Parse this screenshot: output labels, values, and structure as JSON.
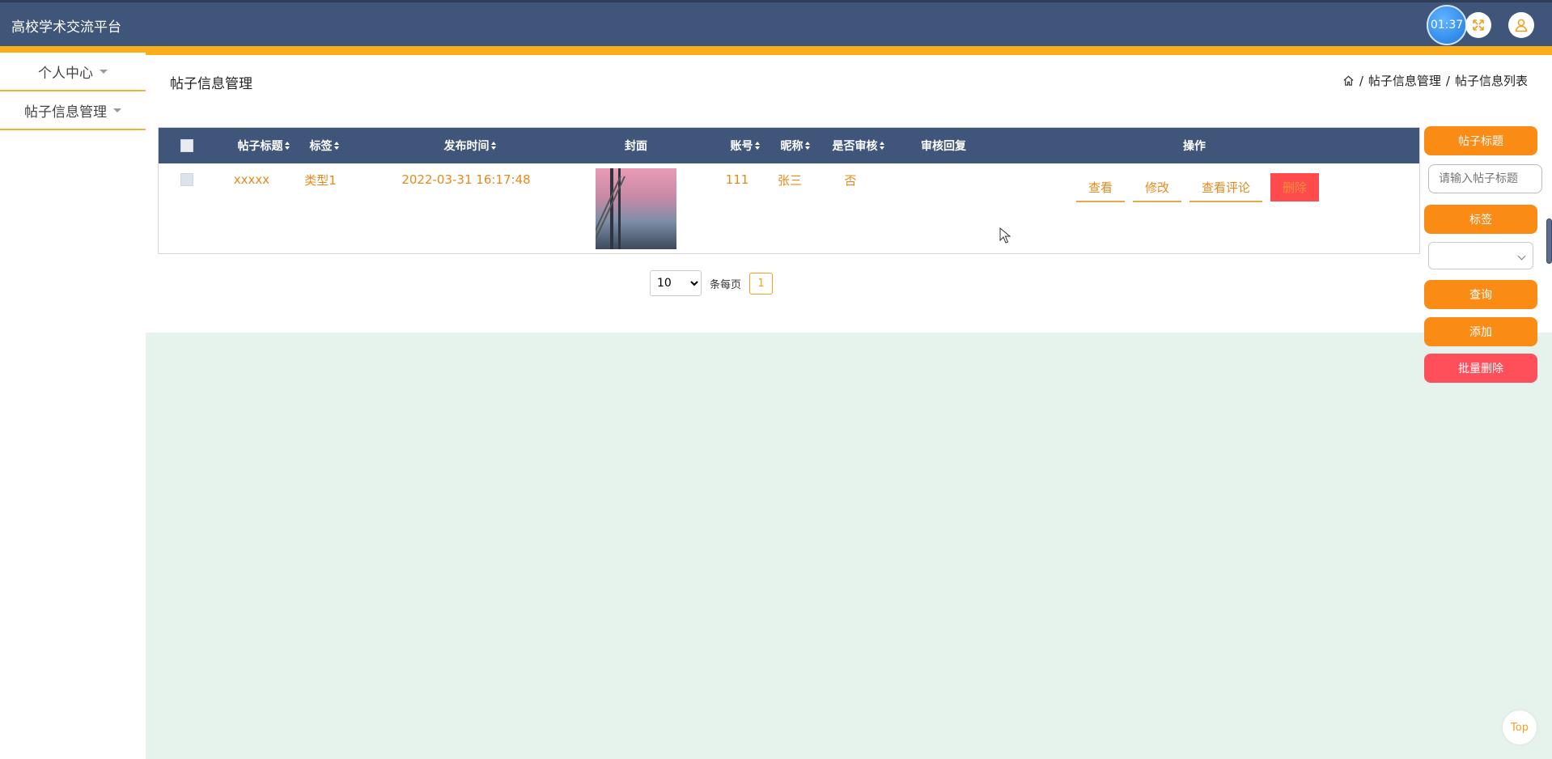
{
  "header": {
    "app_title": "高校学术交流平台",
    "timer": "01:37",
    "colors": {
      "bar": "#40557a",
      "accent": "#fbad1a"
    }
  },
  "sidebar": {
    "items": [
      {
        "label": "个人中心"
      },
      {
        "label": "帖子信息管理"
      }
    ]
  },
  "page": {
    "title": "帖子信息管理",
    "breadcrumb": [
      "帖子信息管理",
      "帖子信息列表"
    ],
    "breadcrumb_sep": "/"
  },
  "table": {
    "columns": [
      "帖子标题",
      "标签",
      "发布时间",
      "封面",
      "账号",
      "昵称",
      "是否审核",
      "审核回复",
      "操作"
    ],
    "rows": [
      {
        "title": "xxxxx",
        "tag": "类型1",
        "time": "2022-03-31 16:17:48",
        "account": "111",
        "nickname": "张三",
        "reviewed": "否",
        "reply": "",
        "actions": {
          "view": "查看",
          "edit": "修改",
          "comments": "查看评论",
          "delete": "删除"
        }
      }
    ]
  },
  "pagination": {
    "page_size": "10",
    "page_size_options": [
      "10"
    ],
    "per_page_label": "条每页",
    "current_page": "1"
  },
  "search_panel": {
    "title_label": "帖子标题",
    "title_placeholder": "请输入帖子标题",
    "tag_label": "标签",
    "query_button": "查询",
    "add_button": "添加",
    "batch_delete_button": "批量删除"
  },
  "top_button": "Top"
}
